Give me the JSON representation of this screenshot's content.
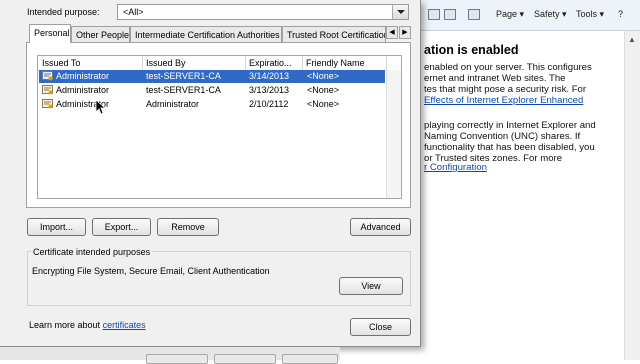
{
  "browser": {
    "toolbar": {
      "page": "Page",
      "safety": "Safety",
      "tools": "Tools"
    },
    "heading": "ation is enabled",
    "paragraph1": [
      "enabled on your server. This configures",
      "ernet and intranet Web sites. The",
      "tes that might pose a security risk. For"
    ],
    "link1": "Effects of Internet Explorer Enhanced",
    "paragraph2": [
      "playing correctly in Internet Explorer and",
      "Naming Convention (UNC) shares. If",
      "functionality that has been disabled, you",
      "or Trusted sites zones. For more"
    ],
    "link2": "r Configuration"
  },
  "dialog": {
    "intended_purpose_label": "Intended purpose:",
    "intended_purpose_value": "<All>",
    "tabs": [
      {
        "label": "Personal",
        "active": true
      },
      {
        "label": "Other People",
        "active": false
      },
      {
        "label": "Intermediate Certification Authorities",
        "active": false
      },
      {
        "label": "Trusted Root Certification",
        "active": false
      }
    ],
    "columns": [
      "Issued To",
      "Issued By",
      "Expiratio...",
      "Friendly Name"
    ],
    "rows": [
      {
        "issued_to": "Administrator",
        "issued_by": "test-SERVER1-CA",
        "expiration": "3/14/2013",
        "friendly_name": "<None>",
        "selected": true
      },
      {
        "issued_to": "Administrator",
        "issued_by": "test-SERVER1-CA",
        "expiration": "3/13/2013",
        "friendly_name": "<None>",
        "selected": false
      },
      {
        "issued_to": "Administrator",
        "issued_by": "Administrator",
        "expiration": "2/10/2112",
        "friendly_name": "<None>",
        "selected": false
      }
    ],
    "buttons": {
      "import": "Import...",
      "export": "Export...",
      "remove": "Remove",
      "advanced": "Advanced",
      "view": "View",
      "close": "Close"
    },
    "purposes_group_title": "Certificate intended purposes",
    "purposes_text": "Encrypting File System, Secure Email, Client Authentication",
    "learn_more_prefix": "Learn more about",
    "learn_more_link": "certificates"
  },
  "colors": {
    "selection": "#3169c6",
    "link": "#0b4bb0",
    "dialog_bg": "#f0f0f0"
  }
}
